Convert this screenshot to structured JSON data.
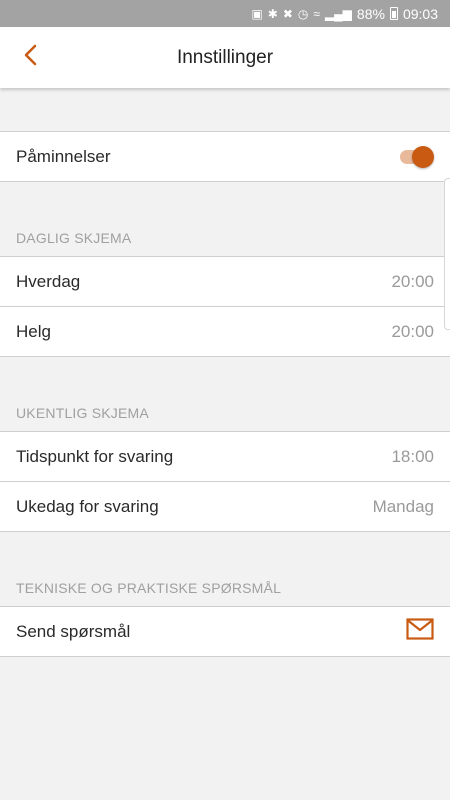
{
  "status_bar": {
    "battery": "88%",
    "time": "09:03"
  },
  "header": {
    "title": "Innstillinger",
    "back_icon": "chevron-left-icon"
  },
  "reminders": {
    "label": "Påminnelser",
    "enabled": true
  },
  "daily": {
    "header": "DAGLIG SKJEMA",
    "items": [
      {
        "label": "Hverdag",
        "value": "20:00"
      },
      {
        "label": "Helg",
        "value": "20:00"
      }
    ]
  },
  "weekly": {
    "header": "UKENTLIG SKJEMA",
    "items": [
      {
        "label": "Tidspunkt for svaring",
        "value": "18:00"
      },
      {
        "label": "Ukedag for svaring",
        "value": "Mandag"
      }
    ]
  },
  "technical": {
    "header": "TEKNISKE OG PRAKTISKE SPØRSMÅL",
    "items": [
      {
        "label": "Send spørsmål",
        "icon": "mail-icon"
      }
    ]
  },
  "colors": {
    "accent": "#c85a12",
    "accent_track": "#e9b99b",
    "background": "#f2f2f2",
    "status_bar": "#a3a3a3"
  }
}
